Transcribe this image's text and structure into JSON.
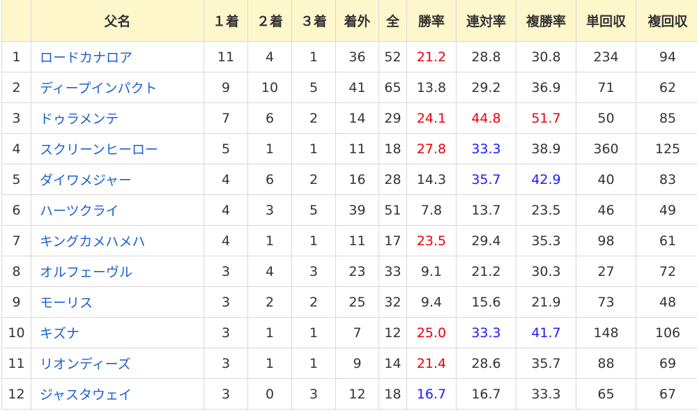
{
  "table": {
    "headers": [
      "",
      "父名",
      "１着",
      "２着",
      "３着",
      "着外",
      "全",
      "勝率",
      "連対率",
      "複勝率",
      "単回収",
      "複回収"
    ],
    "colors": {
      "red": "#e8000b",
      "blue": "#1a1aff",
      "link": "#1a5fd0",
      "header_bg": "#fff7cc"
    },
    "rows": [
      {
        "rank": "1",
        "name": "ロードカナロア",
        "win1": "11",
        "win2": "4",
        "win3": "1",
        "out": "36",
        "total": "52",
        "win_rate": "21.2",
        "quinella_rate": "28.8",
        "place_rate": "30.8",
        "win_return": "234",
        "place_return": "94",
        "hl": {
          "win_rate": "red"
        }
      },
      {
        "rank": "2",
        "name": "ディープインパクト",
        "win1": "9",
        "win2": "10",
        "win3": "5",
        "out": "41",
        "total": "65",
        "win_rate": "13.8",
        "quinella_rate": "29.2",
        "place_rate": "36.9",
        "win_return": "71",
        "place_return": "62",
        "hl": {}
      },
      {
        "rank": "3",
        "name": "ドゥラメンテ",
        "win1": "7",
        "win2": "6",
        "win3": "2",
        "out": "14",
        "total": "29",
        "win_rate": "24.1",
        "quinella_rate": "44.8",
        "place_rate": "51.7",
        "win_return": "50",
        "place_return": "85",
        "hl": {
          "win_rate": "red",
          "quinella_rate": "red",
          "place_rate": "red"
        }
      },
      {
        "rank": "4",
        "name": "スクリーンヒーロー",
        "win1": "5",
        "win2": "1",
        "win3": "1",
        "out": "11",
        "total": "18",
        "win_rate": "27.8",
        "quinella_rate": "33.3",
        "place_rate": "38.9",
        "win_return": "360",
        "place_return": "125",
        "hl": {
          "win_rate": "red",
          "quinella_rate": "blue"
        }
      },
      {
        "rank": "5",
        "name": "ダイワメジャー",
        "win1": "4",
        "win2": "6",
        "win3": "2",
        "out": "16",
        "total": "28",
        "win_rate": "14.3",
        "quinella_rate": "35.7",
        "place_rate": "42.9",
        "win_return": "40",
        "place_return": "83",
        "hl": {
          "quinella_rate": "blue",
          "place_rate": "blue"
        }
      },
      {
        "rank": "6",
        "name": "ハーツクライ",
        "win1": "4",
        "win2": "3",
        "win3": "5",
        "out": "39",
        "total": "51",
        "win_rate": "7.8",
        "quinella_rate": "13.7",
        "place_rate": "23.5",
        "win_return": "46",
        "place_return": "49",
        "hl": {}
      },
      {
        "rank": "7",
        "name": "キングカメハメハ",
        "win1": "4",
        "win2": "1",
        "win3": "1",
        "out": "11",
        "total": "17",
        "win_rate": "23.5",
        "quinella_rate": "29.4",
        "place_rate": "35.3",
        "win_return": "98",
        "place_return": "61",
        "hl": {
          "win_rate": "red"
        }
      },
      {
        "rank": "8",
        "name": "オルフェーヴル",
        "win1": "3",
        "win2": "4",
        "win3": "3",
        "out": "23",
        "total": "33",
        "win_rate": "9.1",
        "quinella_rate": "21.2",
        "place_rate": "30.3",
        "win_return": "27",
        "place_return": "72",
        "hl": {}
      },
      {
        "rank": "9",
        "name": "モーリス",
        "win1": "3",
        "win2": "2",
        "win3": "2",
        "out": "25",
        "total": "32",
        "win_rate": "9.4",
        "quinella_rate": "15.6",
        "place_rate": "21.9",
        "win_return": "73",
        "place_return": "48",
        "hl": {}
      },
      {
        "rank": "10",
        "name": "キズナ",
        "win1": "3",
        "win2": "1",
        "win3": "1",
        "out": "7",
        "total": "12",
        "win_rate": "25.0",
        "quinella_rate": "33.3",
        "place_rate": "41.7",
        "win_return": "148",
        "place_return": "106",
        "hl": {
          "win_rate": "red",
          "quinella_rate": "blue",
          "place_rate": "blue"
        }
      },
      {
        "rank": "11",
        "name": "リオンディーズ",
        "win1": "3",
        "win2": "1",
        "win3": "1",
        "out": "9",
        "total": "14",
        "win_rate": "21.4",
        "quinella_rate": "28.6",
        "place_rate": "35.7",
        "win_return": "88",
        "place_return": "69",
        "hl": {
          "win_rate": "red"
        }
      },
      {
        "rank": "12",
        "name": "ジャスタウェイ",
        "win1": "3",
        "win2": "0",
        "win3": "3",
        "out": "12",
        "total": "18",
        "win_rate": "16.7",
        "quinella_rate": "16.7",
        "place_rate": "33.3",
        "win_return": "65",
        "place_return": "67",
        "hl": {
          "win_rate": "blue"
        }
      }
    ]
  }
}
